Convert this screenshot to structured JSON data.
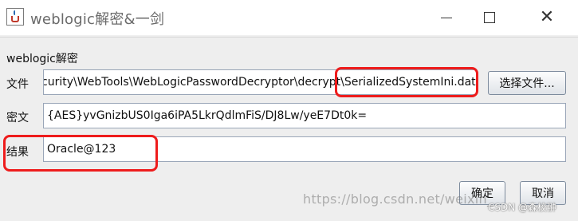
{
  "window": {
    "title": "weblogic解密&一剑",
    "icon": "java-cup-icon",
    "controls": {
      "minimize": "minimize-icon",
      "maximize": "maximize-icon",
      "close": "close-icon"
    }
  },
  "form": {
    "section_label": "weblogic解密",
    "file": {
      "label": "文件",
      "value": "curity\\WebTools\\WebLogicPasswordDecryptor\\decrypt\\SerializedSystemIni.dat",
      "button": "选择文件..."
    },
    "cipher": {
      "label": "密文",
      "value": "{AES}yvGnizbUS0Iga6iPA5LkrQdlmFiS/DJ8Lw/yeE7Dt0k="
    },
    "result": {
      "label": "结果",
      "value": "Oracle@123"
    },
    "buttons": {
      "ok": "确定",
      "cancel": "取消"
    }
  },
  "annotations": {
    "highlight_color": "#ee1c1c"
  },
  "watermark": {
    "url": "https://blog.csdn.net/weixin_",
    "tag": "CSDN @森校翀"
  }
}
